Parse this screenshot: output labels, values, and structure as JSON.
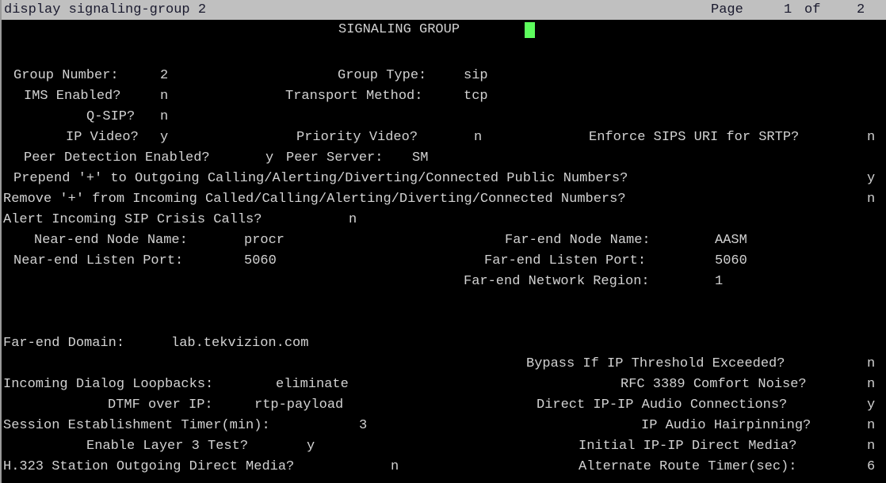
{
  "terminal": {
    "command_line": "display signaling-group 2",
    "page_label": "Page",
    "page_current": "1",
    "page_of": "of",
    "page_total": "2",
    "screen_title": "SIGNALING GROUP",
    "cursor_visible": true,
    "colors": {
      "header_bg": "#c0c0c0",
      "header_fg": "#1a1a2e",
      "body_bg": "#000000",
      "body_fg": "#d2d2d2",
      "cursor": "#5dfc5d"
    }
  },
  "fields": {
    "group_number_label": "Group Number:",
    "group_number_value": "2",
    "group_type_label": "Group Type:",
    "group_type_value": "sip",
    "ims_enabled_label": "IMS Enabled?",
    "ims_enabled_value": "n",
    "transport_method_label": "Transport Method:",
    "transport_method_value": "tcp",
    "qsip_label": "Q-SIP?",
    "qsip_value": "n",
    "ip_video_label": "IP Video?",
    "ip_video_value": "y",
    "priority_video_label": "Priority Video?",
    "priority_video_value": "n",
    "enforce_sips_uri_label": "Enforce SIPS URI for SRTP?",
    "enforce_sips_uri_value": "n",
    "peer_detection_label": "Peer Detection Enabled?",
    "peer_detection_value": "y",
    "peer_server_label": "Peer Server:",
    "peer_server_value": "SM",
    "prepend_plus_label": "Prepend '+' to Outgoing Calling/Alerting/Diverting/Connected Public Numbers?",
    "prepend_plus_value": "y",
    "remove_plus_label": "Remove '+' from Incoming Called/Calling/Alerting/Diverting/Connected Numbers?",
    "remove_plus_value": "n",
    "alert_crisis_label": "Alert Incoming SIP Crisis Calls?",
    "alert_crisis_value": "n",
    "near_end_node_label": "Near-end Node Name:",
    "near_end_node_value": "procr",
    "far_end_node_label": "Far-end Node Name:",
    "far_end_node_value": "AASM",
    "near_end_port_label": "Near-end Listen Port:",
    "near_end_port_value": "5060",
    "far_end_port_label": "Far-end Listen Port:",
    "far_end_port_value": "5060",
    "far_end_region_label": "Far-end Network Region:",
    "far_end_region_value": "1",
    "far_end_domain_label": "Far-end Domain:",
    "far_end_domain_value": "lab.tekvizion.com",
    "bypass_threshold_label": "Bypass If IP Threshold Exceeded?",
    "bypass_threshold_value": "n",
    "incoming_loopbacks_label": "Incoming Dialog Loopbacks:",
    "incoming_loopbacks_value": "eliminate",
    "rfc3389_label": "RFC 3389 Comfort Noise?",
    "rfc3389_value": "n",
    "dtmf_label": "DTMF over IP:",
    "dtmf_value": "rtp-payload",
    "direct_ipip_audio_label": "Direct IP-IP Audio Connections?",
    "direct_ipip_audio_value": "y",
    "session_timer_label": "Session Establishment Timer(min):",
    "session_timer_value": "3",
    "ip_hairpinning_label": "IP Audio Hairpinning?",
    "ip_hairpinning_value": "n",
    "layer3_test_label": "Enable Layer 3 Test?",
    "layer3_test_value": "y",
    "initial_ipip_label": "Initial IP-IP Direct Media?",
    "initial_ipip_value": "n",
    "h323_outgoing_label": "H.323 Station Outgoing Direct Media?",
    "h323_outgoing_value": "n",
    "alt_route_timer_label": "Alternate Route Timer(sec):",
    "alt_route_timer_value": "6"
  }
}
